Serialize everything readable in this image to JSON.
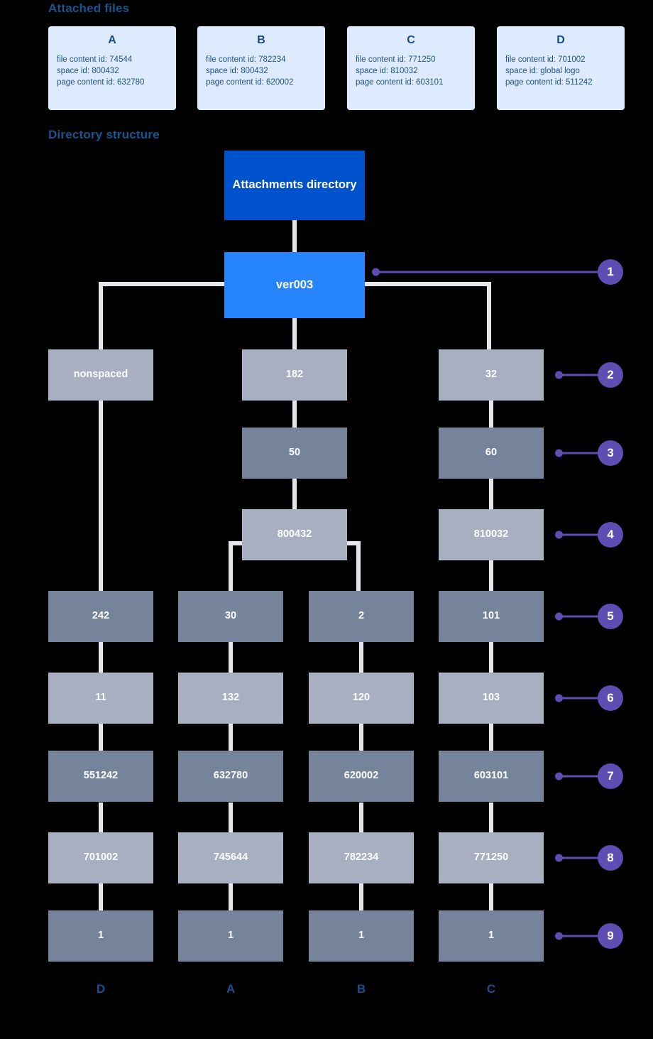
{
  "headings": {
    "attached_files": "Attached files",
    "directory_structure": "Directory structure"
  },
  "colors": {
    "background": "#000000",
    "card_bg": "#DEEBFF",
    "card_text": "#174B87",
    "heading": "#16558F",
    "root_node": "#0052CC",
    "ver_node": "#2684FF",
    "node_light": "#A7AFC0",
    "node_dark": "#76849B",
    "connector": "#E4E6EB",
    "callout": "#5E4DB2",
    "node_text": "#FFFFFF"
  },
  "attached_files": [
    {
      "letter": "A",
      "file_content_id": "file content id: 74544",
      "space_id": "space id: 800432",
      "page_content_id": "page content id: 632780"
    },
    {
      "letter": "B",
      "file_content_id": "file content id: 782234",
      "space_id": "space id: 800432",
      "page_content_id": "page content id: 620002"
    },
    {
      "letter": "C",
      "file_content_id": "file content id: 771250",
      "space_id": "space id: 810032",
      "page_content_id": "page content id: 603101"
    },
    {
      "letter": "D",
      "file_content_id": "file content id: 701002",
      "space_id": "space id: global logo",
      "page_content_id": "page content id: 511242"
    }
  ],
  "tree": {
    "root": "Attachments directory",
    "version": "ver003",
    "rows": {
      "row1": {
        "col_d": "nonspaced",
        "col_a": "182",
        "col_c": "32"
      },
      "row2": {
        "col_a": "50",
        "col_c": "60"
      },
      "row3": {
        "col_a": "800432",
        "col_c": "810032"
      },
      "row4": {
        "col_d": "242",
        "col_a": "30",
        "col_b": "2",
        "col_c": "101"
      },
      "row5": {
        "col_d": "11",
        "col_a": "132",
        "col_b": "120",
        "col_c": "103"
      },
      "row6": {
        "col_d": "551242",
        "col_a": "632780",
        "col_b": "620002",
        "col_c": "603101"
      },
      "row7": {
        "col_d": "701002",
        "col_a": "745644",
        "col_b": "782234",
        "col_c": "771250"
      },
      "row8": {
        "col_d": "1",
        "col_a": "1",
        "col_b": "1",
        "col_c": "1"
      }
    }
  },
  "callouts": [
    {
      "number": "1"
    },
    {
      "number": "2"
    },
    {
      "number": "3"
    },
    {
      "number": "4"
    },
    {
      "number": "5"
    },
    {
      "number": "6"
    },
    {
      "number": "7"
    },
    {
      "number": "8"
    },
    {
      "number": "9"
    }
  ],
  "column_labels": [
    {
      "letter": "D"
    },
    {
      "letter": "A"
    },
    {
      "letter": "B"
    },
    {
      "letter": "C"
    }
  ]
}
